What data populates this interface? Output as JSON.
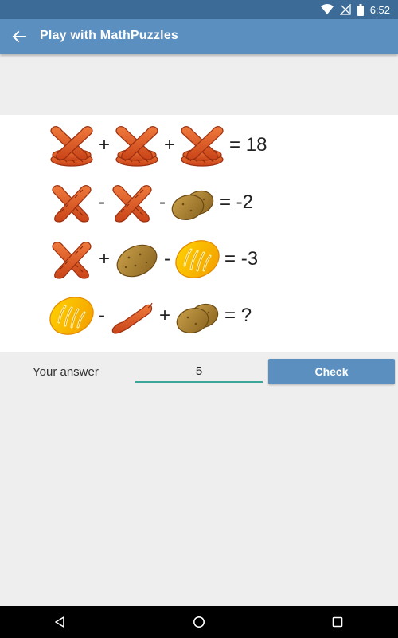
{
  "status_bar": {
    "time": "6:52",
    "icons": [
      "wifi-icon",
      "signal-off-icon",
      "battery-icon"
    ]
  },
  "app_bar": {
    "title": "Play with MathPuzzles",
    "back_icon": "arrow-back-icon"
  },
  "puzzle": {
    "rows": [
      {
        "items": [
          "sausage-pile",
          "+",
          "sausage-pile",
          "+",
          "sausage-pile"
        ],
        "result": "= 18"
      },
      {
        "items": [
          "crossed-sausages",
          "-",
          "crossed-sausages",
          "-",
          "two-potatoes"
        ],
        "result": "= -2"
      },
      {
        "items": [
          "crossed-sausages",
          "+",
          "potato",
          "-",
          "sliced-bread"
        ],
        "result": "= -3"
      },
      {
        "items": [
          "sliced-bread",
          "-",
          "single-sausage",
          "+",
          "two-potatoes"
        ],
        "result": "= ?"
      }
    ],
    "operators": {
      "r1a": "+",
      "r1b": "+",
      "r2a": "-",
      "r2b": "-",
      "r3a": "+",
      "r3b": "-",
      "r4a": "-",
      "r4b": "+"
    }
  },
  "answer": {
    "label": "Your answer",
    "value": "5"
  },
  "check_button": {
    "label": "Check"
  },
  "colors": {
    "status_bar": "#3b6b96",
    "app_bar": "#5b8fc0",
    "button": "#5b8fc0",
    "input_underline": "#3aa79a",
    "background": "#eeeeee"
  },
  "nav_bar": {
    "icons": [
      "back-triangle-icon",
      "home-circle-icon",
      "recents-square-icon"
    ]
  }
}
